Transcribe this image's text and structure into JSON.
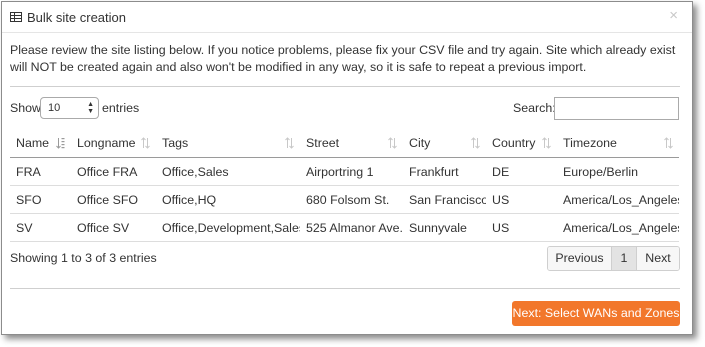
{
  "dialog": {
    "title": "Bulk site creation",
    "close_glyph": "×",
    "icon": "table-icon",
    "intro": "Please review the site listing below. If you notice problems, please fix your CSV file and try again. Site which already exist will NOT be created again and also won't be modified in any way, so it is safe to repeat a previous import."
  },
  "controls": {
    "show_label": "Show",
    "length_value": "10",
    "entries_label": "entries",
    "search_label": "Search:",
    "search_value": ""
  },
  "table": {
    "columns": [
      "Name",
      "Longname",
      "Tags",
      "Street",
      "City",
      "Country",
      "Timezone"
    ],
    "rows": [
      [
        "FRA",
        "Office FRA",
        "Office,Sales",
        "Airportring 1",
        "Frankfurt",
        "DE",
        "Europe/Berlin"
      ],
      [
        "SFO",
        "Office SFO",
        "Office,HQ",
        "680 Folsom St.",
        "San Francisco",
        "US",
        "America/Los_Angeles"
      ],
      [
        "SV",
        "Office SV",
        "Office,Development,Sales",
        "525 Almanor Ave.",
        "Sunnyvale",
        "US",
        "America/Los_Angeles"
      ]
    ]
  },
  "footer": {
    "info": "Showing 1 to 3 of 3 entries",
    "prev_label": "Previous",
    "current_page": "1",
    "next_label": "Next",
    "primary_label": "Next: Select WANs and Zones"
  },
  "colors": {
    "accent": "#f2772b",
    "border": "#8c8c8c"
  }
}
